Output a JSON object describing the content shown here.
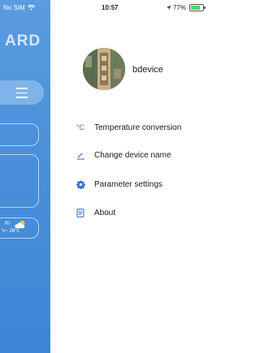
{
  "status_bar": {
    "carrier": "No SIM",
    "time": "10:57",
    "battery_percent": "77%",
    "battery_level": 0.77
  },
  "background": {
    "brand_text": "ARD",
    "weather": {
      "day": "RI",
      "temp": "°c~ 28°c"
    }
  },
  "drawer": {
    "username": "bdevice",
    "menu": [
      {
        "label": "Temperature conversion",
        "icon": "celsius-icon"
      },
      {
        "label": "Change device name",
        "icon": "edit-pencil-icon"
      },
      {
        "label": "Parameter settings",
        "icon": "gear-icon"
      },
      {
        "label": "About",
        "icon": "document-icon"
      }
    ]
  },
  "colors": {
    "accent": "#3f6fd1",
    "background_blue": "#4a8fd9"
  }
}
